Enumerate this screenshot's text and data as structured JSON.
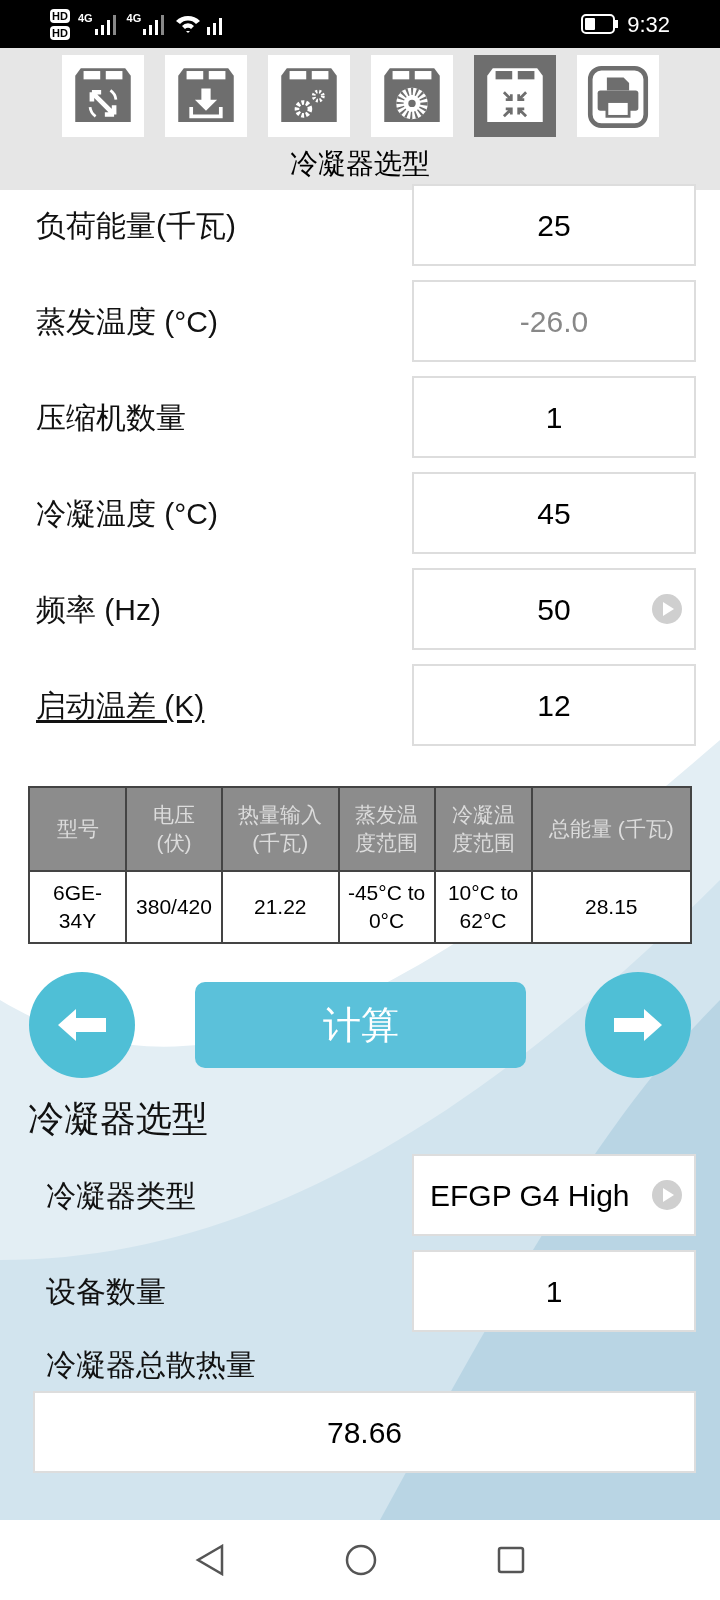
{
  "status_bar": {
    "sim_1": "HD",
    "sim_2": "HD",
    "time": "9:32",
    "network_1": "4G",
    "network_2": "4G"
  },
  "toolbar": {
    "icons": [
      {
        "kind": "rotate",
        "selected": false
      },
      {
        "kind": "download",
        "selected": false
      },
      {
        "kind": "gears",
        "selected": false
      },
      {
        "kind": "fan",
        "selected": false
      },
      {
        "kind": "compress",
        "selected": true
      },
      {
        "kind": "print",
        "selected": false
      }
    ],
    "title": "冷凝器选型"
  },
  "fields": [
    {
      "label": "负荷能量(千瓦)",
      "value": "25",
      "kind": "input",
      "disabled": false,
      "link": false
    },
    {
      "label": "蒸发温度 (°C)",
      "value": "-26.0",
      "kind": "input",
      "disabled": true,
      "link": false
    },
    {
      "label": "压缩机数量",
      "value": "1",
      "kind": "input",
      "disabled": false,
      "link": false
    },
    {
      "label": "冷凝温度 (°C)",
      "value": "45",
      "kind": "input",
      "disabled": false,
      "link": false
    },
    {
      "label": "频率 (Hz)",
      "value": "50",
      "kind": "select",
      "disabled": false,
      "link": false
    },
    {
      "label": "启动温差 (K)",
      "value": "12",
      "kind": "input",
      "disabled": false,
      "link": true
    }
  ],
  "table": {
    "columns": [
      "型号",
      "电压 (伏)",
      "热量输入 (千瓦)",
      "蒸发温度范围",
      "冷凝温度范围",
      "总能量 (千瓦)"
    ],
    "rows": [
      [
        "6GE-34Y",
        "380/420",
        "21.22",
        "-45°C to 0°C",
        "10°C to 62°C",
        "28.15"
      ]
    ]
  },
  "actions": {
    "calculate": "计算"
  },
  "condenser": {
    "title": "冷凝器选型",
    "fields": [
      {
        "label": "冷凝器类型",
        "value": "EFGP G4 High",
        "kind": "select"
      },
      {
        "label": "设备数量",
        "value": "1",
        "kind": "input"
      }
    ],
    "total_label": "冷凝器总散热量",
    "total_value": "78.66"
  }
}
